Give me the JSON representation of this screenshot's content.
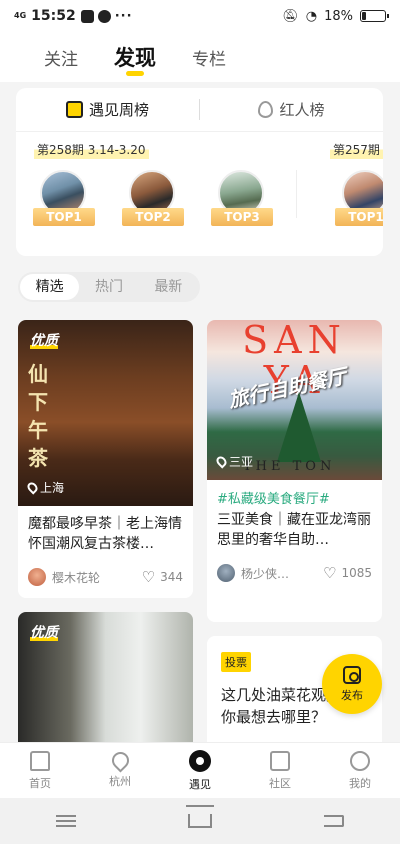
{
  "status_bar": {
    "network": "4G",
    "time": "15:52",
    "more": "···",
    "battery": "18%",
    "battery_level": 0.18
  },
  "top_tabs": [
    {
      "label": "关注",
      "active": false
    },
    {
      "label": "发现",
      "active": true
    },
    {
      "label": "专栏",
      "active": false
    }
  ],
  "rank_card": {
    "tabs": [
      {
        "label": "遇见周榜",
        "icon": "rank-icon"
      },
      {
        "label": "红人榜",
        "icon": "flame-icon"
      }
    ],
    "current_week": "第258期 3.14-3.20",
    "next_week": "第257期",
    "badges": [
      "TOP1",
      "TOP2",
      "TOP3",
      "TOP1"
    ]
  },
  "filter": {
    "options": [
      "精选",
      "热门",
      "最新"
    ],
    "selected": "精选"
  },
  "feed": [
    {
      "badge": "优质",
      "cover_text": "仙下午茶",
      "location": "上海",
      "title": "魔都最哆早茶｜老上海情怀国潮风复古茶楼…",
      "author": "樱木花轮",
      "likes": "344"
    },
    {
      "cover_text": "SAN YA",
      "cover_script": "旅行自助餐厅",
      "cover_foot": "THE TON",
      "location": "三亚",
      "tag": "#私藏级美食餐厅#",
      "title": "三亚美食｜藏在亚龙湾丽思里的奢华自助…",
      "author": "杨少侠…",
      "likes": "1085"
    },
    {
      "badge": "优质"
    },
    {
      "vote_tag": "投票",
      "title": "这几处油菜花观赏地，你最想去哪里？"
    }
  ],
  "fab": {
    "label": "发布"
  },
  "bottom_nav": [
    {
      "label": "首页",
      "icon": "home-icon",
      "active": false
    },
    {
      "label": "杭州",
      "icon": "location-icon",
      "active": false
    },
    {
      "label": "遇见",
      "icon": "discover-icon",
      "active": true
    },
    {
      "label": "社区",
      "icon": "community-icon",
      "active": false
    },
    {
      "label": "我的",
      "icon": "profile-icon",
      "active": false
    }
  ]
}
